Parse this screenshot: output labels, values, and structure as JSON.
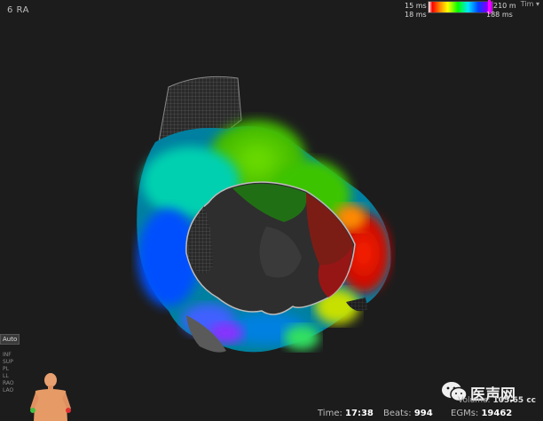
{
  "map": {
    "title": "6 RA"
  },
  "color_scale": {
    "min_label": "15 ms",
    "max_label": "210 m",
    "min_label_2": "18 ms",
    "max_label_2": "188 ms",
    "menu_label": "Tim"
  },
  "views": {
    "auto_label": "Auto",
    "items": [
      "INF",
      "SUP",
      "PL",
      "LL",
      "RAO",
      "LAO"
    ]
  },
  "watermark": {
    "text": "医声网"
  },
  "status": {
    "time_label": "Time:",
    "time_value": "17:38",
    "beats_label": "Beats:",
    "beats_value": "994",
    "egms_label": "EGMs:",
    "egms_value": "19462",
    "volume_label": "Volume:",
    "volume_value": "105.65 cc"
  }
}
